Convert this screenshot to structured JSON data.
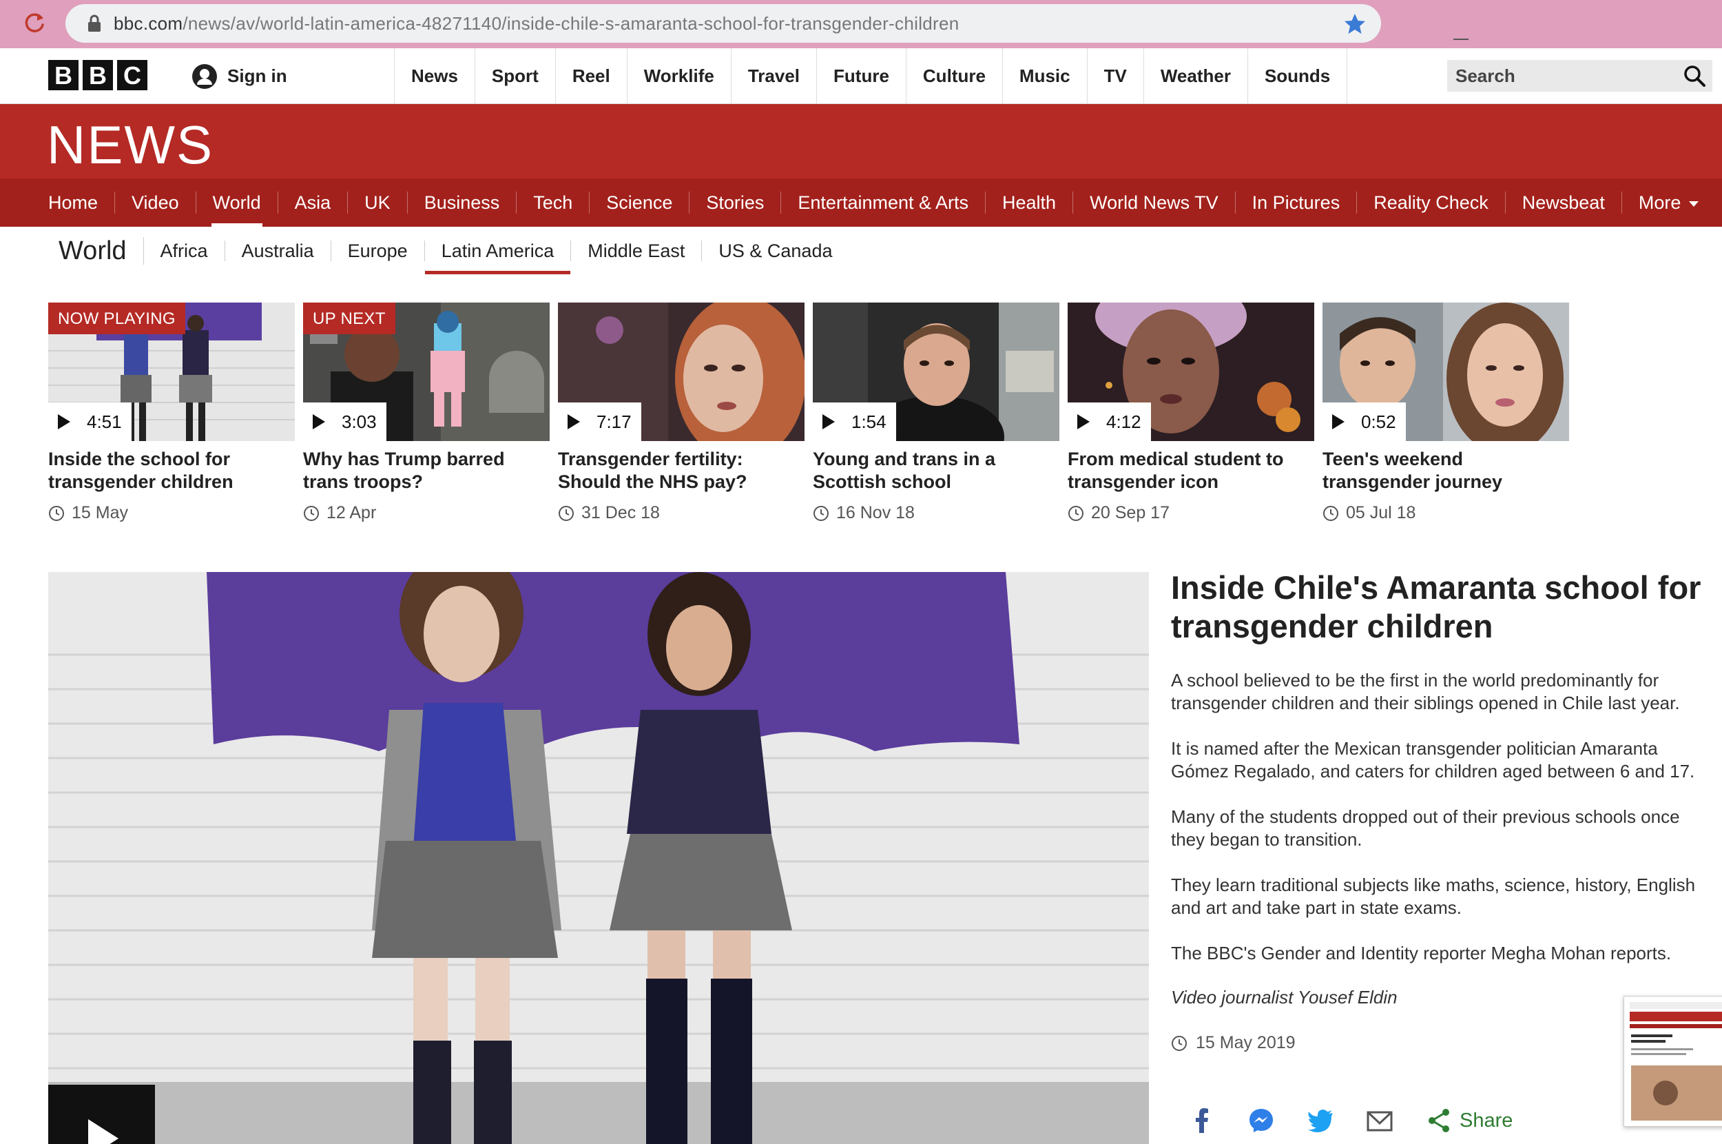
{
  "browser": {
    "url_host": "bbc.com",
    "url_path": "/news/av/world-latin-america-48271140/inside-chile-s-amaranta-school-for-transgender-children"
  },
  "bbc_bar": {
    "logo_letters": [
      "B",
      "B",
      "C"
    ],
    "sign_in": "Sign in",
    "nav": [
      "News",
      "Sport",
      "Reel",
      "Worklife",
      "Travel",
      "Future",
      "Culture",
      "Music",
      "TV",
      "Weather",
      "Sounds"
    ],
    "search_placeholder": "Search"
  },
  "news_header": {
    "logo": "NEWS",
    "sections": [
      "Home",
      "Video",
      "World",
      "Asia",
      "UK",
      "Business",
      "Tech",
      "Science",
      "Stories",
      "Entertainment & Arts",
      "Health",
      "World News TV",
      "In Pictures",
      "Reality Check",
      "Newsbeat",
      "More"
    ],
    "active_section": "World"
  },
  "sub_nav": {
    "title": "World",
    "items": [
      "Africa",
      "Australia",
      "Europe",
      "Latin America",
      "Middle East",
      "US & Canada"
    ],
    "active": "Latin America"
  },
  "videos": [
    {
      "badge": "NOW PLAYING",
      "duration": "4:51",
      "title": "Inside the school for transgender children",
      "date": "15 May"
    },
    {
      "badge": "UP NEXT",
      "duration": "3:03",
      "title": "Why has Trump barred trans troops?",
      "date": "12 Apr"
    },
    {
      "badge": "",
      "duration": "7:17",
      "title": "Transgender fertility: Should the NHS pay?",
      "date": "31 Dec 18"
    },
    {
      "badge": "",
      "duration": "1:54",
      "title": "Young and trans in a Scottish school",
      "date": "16 Nov 18"
    },
    {
      "badge": "",
      "duration": "4:12",
      "title": "From medical student to transgender icon",
      "date": "20 Sep 17"
    },
    {
      "badge": "",
      "duration": "0:52",
      "title": "Teen's weekend transgender journey",
      "date": "05 Jul 18"
    }
  ],
  "article": {
    "title": "Inside Chile's Amaranta school for transgender children",
    "paragraphs": [
      "A school believed to be the first in the world predominantly for transgender children and their siblings opened in Chile last year.",
      "It is named after the Mexican transgender politician Amaranta Gómez Regalado, and caters for children aged between 6 and 17.",
      "Many of the students dropped out of their previous schools once they began to transition.",
      "They learn traditional subjects like maths, science, history, English and art and take part in state exams.",
      "The BBC's Gender and Identity reporter Megha Mohan reports."
    ],
    "byline": "Video journalist Yousef Eldin",
    "date": "15 May 2019",
    "share_label": "Share"
  },
  "colors": {
    "news_red": "#b52a25",
    "nav_red": "#a3211c",
    "browser_pink": "#df9fbd",
    "share_green": "#2e7d32"
  }
}
